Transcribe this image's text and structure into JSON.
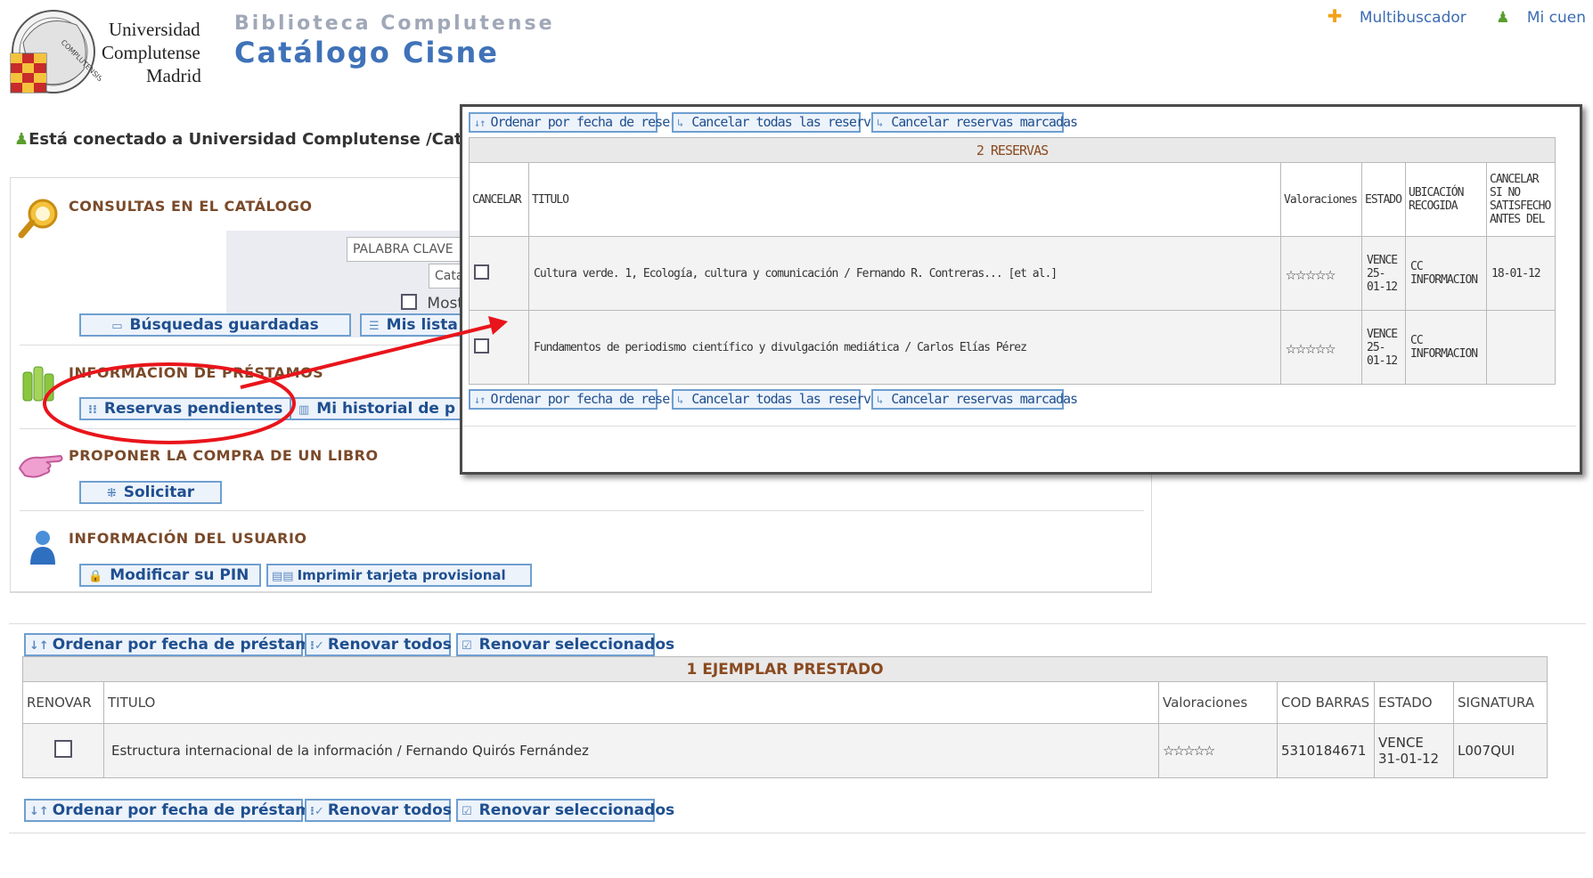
{
  "header": {
    "university_lines": [
      "Universidad",
      "Complutense",
      "Madrid"
    ],
    "crest_text": "COMPLUTENSIS",
    "subtitle": "Biblioteca Complutense",
    "title": "Catálogo Cisne",
    "top_links": [
      "Multibuscador",
      "Mi cuen"
    ]
  },
  "status": {
    "connected": "Está conectado a Universidad Complutense /Catálo"
  },
  "sections": {
    "consultas": {
      "title": "CONSULTAS EN EL CATÁLOGO",
      "search_type": "PALABRA CLAVE",
      "catalog": "Cata",
      "show_label": "Most",
      "saved_button": "Búsquedas guardadas",
      "lists_button": "Mis lista"
    },
    "prestamos": {
      "title": "INFORMACIÓN DE PRÉSTAMOS",
      "reservas_button": "Reservas pendientes",
      "historial_button": "Mi historial de p"
    },
    "compra": {
      "title": "PROPONER LA COMPRA DE UN LIBRO",
      "button": "Solicitar"
    },
    "usuario": {
      "title": "INFORMACIÓN DEL USUARIO",
      "pin_button": "Modificar su PIN",
      "card_button": "Imprimir tarjeta provisional"
    }
  },
  "loans": {
    "buttons": [
      "Ordenar por fecha de préstamo",
      "Renovar todos",
      "Renovar seleccionados"
    ],
    "caption": "1 EJEMPLAR PRESTADO",
    "columns": [
      "RENOVAR",
      "TITULO",
      "Valoraciones",
      "COD BARRAS",
      "ESTADO",
      "SIGNATURA"
    ],
    "rows": [
      {
        "title": "Estructura internacional de la información / Fernando Quirós Fernández",
        "rating": "☆☆☆☆☆",
        "barcode": "5310184671",
        "status": "VENCE 31-01-12",
        "signature": "L007QUI"
      }
    ]
  },
  "reservations": {
    "buttons": [
      "Ordenar por fecha de reserva",
      "Cancelar todas las reservas",
      "Cancelar reservas marcadas"
    ],
    "caption": "2 RESERVAS",
    "columns": [
      "CANCELAR",
      "TITULO",
      "Valoraciones",
      "ESTADO",
      "UBICACIÓN RECOGIDA",
      "CANCELAR SI NO SATISFECHO ANTES DEL"
    ],
    "rows": [
      {
        "title": "Cultura verde. 1, Ecología, cultura y comunicación / Fernando R. Contreras... [et al.]",
        "rating": "☆☆☆☆☆",
        "status": "VENCE 25-01-12",
        "location": "CC INFORMACION",
        "cancel_before": "18-01-12"
      },
      {
        "title": "Fundamentos de periodismo científico y divulgación mediática / Carlos Elías Pérez",
        "rating": "☆☆☆☆☆",
        "status": "VENCE 25-01-12",
        "location": "CC INFORMACION",
        "cancel_before": ""
      }
    ]
  },
  "colors": {
    "annotation": "#e8151b",
    "link": "#34649e",
    "section_title": "#7a4a2a",
    "caption": "#8a4a20"
  }
}
